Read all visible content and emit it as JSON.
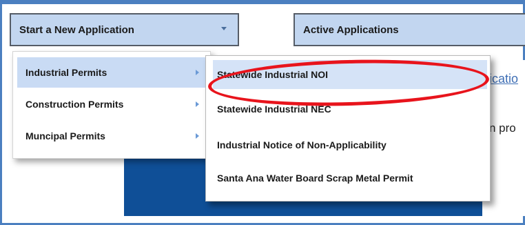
{
  "toolbar": {
    "new_application": "Start a New Application",
    "active_applications": "Active Applications"
  },
  "background": {
    "link_fragment": "icatio",
    "text_fragment": "n pro"
  },
  "menu": {
    "items": [
      {
        "label": "Industrial Permits",
        "highlighted": true,
        "has_submenu": true
      },
      {
        "label": "Construction Permits",
        "highlighted": false,
        "has_submenu": true
      },
      {
        "label": "Muncipal Permits",
        "highlighted": false,
        "has_submenu": true
      }
    ]
  },
  "submenu": {
    "items": [
      {
        "label": "Statewide Industrial NOI",
        "highlighted": true
      },
      {
        "label": "Statewide Industrial NEC",
        "highlighted": false
      },
      {
        "label": "Industrial Notice of Non-Applicability",
        "highlighted": false
      },
      {
        "label": "Santa Ana Water Board Scrap Metal Permit",
        "highlighted": false
      }
    ]
  },
  "colors": {
    "button_bg": "#c2d6f0",
    "menu_highlight": "#c9dbf4",
    "panel_blue": "#0f4f97",
    "annotation_red": "#e8141c",
    "frame_blue": "#4b7fc0"
  },
  "icons": [
    "chevron-down-icon",
    "chevron-right-icon"
  ]
}
